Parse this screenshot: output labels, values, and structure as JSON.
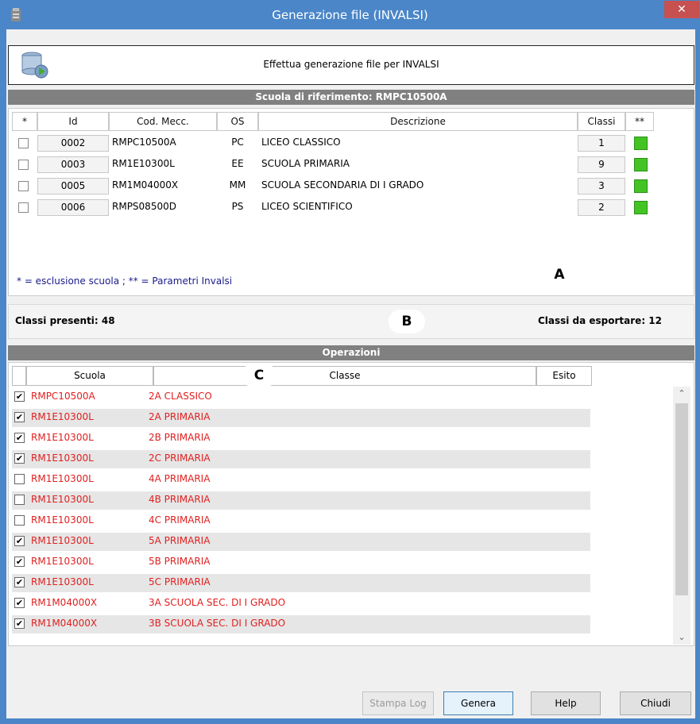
{
  "window": {
    "title": "Generazione file (INVALSI)",
    "close_glyph": "✕"
  },
  "header": {
    "text": "Effettua generazione file per INVALSI",
    "icon": "database-run-icon"
  },
  "schools_section": {
    "title": "Scuola di riferimento: RMPC10500A",
    "columns": [
      "*",
      "Id",
      "Cod. Mecc.",
      "OS",
      "Descrizione",
      "Classi",
      "**"
    ],
    "rows": [
      {
        "id": "0002",
        "cod": "RMPC10500A",
        "os": "PC",
        "descr": "LICEO CLASSICO",
        "classi": "1",
        "excluded": false
      },
      {
        "id": "0003",
        "cod": "RM1E10300L",
        "os": "EE",
        "descr": "SCUOLA PRIMARIA",
        "classi": "9",
        "excluded": false
      },
      {
        "id": "0005",
        "cod": "RM1M04000X",
        "os": "MM",
        "descr": "SCUOLA SECONDARIA DI I GRADO",
        "classi": "3",
        "excluded": false
      },
      {
        "id": "0006",
        "cod": "RMPS08500D",
        "os": "PS",
        "descr": "LICEO SCIENTIFICO",
        "classi": "2",
        "excluded": false
      }
    ],
    "legend": "* = esclusione scuola ; ** = Parametri Invalsi",
    "marker": "A"
  },
  "info": {
    "classi_presenti": "Classi presenti: 48",
    "classi_da_esportare": "Classi da esportare: 12",
    "marker": "B"
  },
  "operations": {
    "title": "Operazioni",
    "columns": [
      "Scuola",
      "Classe",
      "Esito"
    ],
    "marker": "C",
    "rows": [
      {
        "scuola": "RMPC10500A",
        "classe": "2A CLASSICO",
        "checked": true
      },
      {
        "scuola": "RM1E10300L",
        "classe": "2A PRIMARIA",
        "checked": true
      },
      {
        "scuola": "RM1E10300L",
        "classe": "2B PRIMARIA",
        "checked": true
      },
      {
        "scuola": "RM1E10300L",
        "classe": "2C PRIMARIA",
        "checked": true
      },
      {
        "scuola": "RM1E10300L",
        "classe": "4A PRIMARIA",
        "checked": false
      },
      {
        "scuola": "RM1E10300L",
        "classe": "4B PRIMARIA",
        "checked": false
      },
      {
        "scuola": "RM1E10300L",
        "classe": "4C PRIMARIA",
        "checked": false
      },
      {
        "scuola": "RM1E10300L",
        "classe": "5A PRIMARIA",
        "checked": true
      },
      {
        "scuola": "RM1E10300L",
        "classe": "5B PRIMARIA",
        "checked": true
      },
      {
        "scuola": "RM1E10300L",
        "classe": "5C PRIMARIA",
        "checked": true
      },
      {
        "scuola": "RM1M04000X",
        "classe": "3A SCUOLA SEC. DI I GRADO",
        "checked": true
      },
      {
        "scuola": "RM1M04000X",
        "classe": "3B SCUOLA SEC. DI I GRADO",
        "checked": true
      }
    ]
  },
  "buttons": {
    "stampa_log": "Stampa Log",
    "genera": "Genera",
    "help": "Help",
    "chiudi": "Chiudi"
  },
  "colors": {
    "title_bar": "#4a86c8",
    "close": "#c75050",
    "section_bar": "#808080",
    "param_ok": "#44c424",
    "operation_text": "#e02020"
  }
}
